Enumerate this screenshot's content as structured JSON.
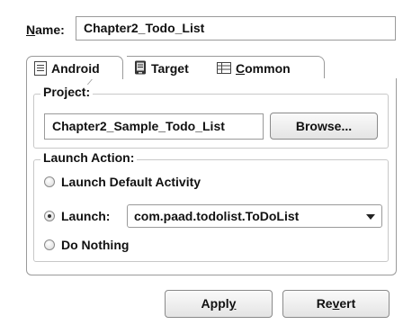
{
  "name_field": {
    "label": "Name:",
    "label_mnemonic": "N",
    "label_rest": "ame:",
    "value": "Chapter2_Todo_List"
  },
  "tabs": [
    {
      "label": "Android",
      "active": true,
      "icon": "android-document-icon"
    },
    {
      "label": "Target",
      "active": false,
      "icon": "target-device-icon"
    },
    {
      "label": "Common",
      "mnemonic": "C",
      "rest": "ommon",
      "active": false,
      "icon": "common-table-icon"
    }
  ],
  "project": {
    "group_title": "Project:",
    "value": "Chapter2_Sample_Todo_List",
    "browse_label": "Browse..."
  },
  "launch_action": {
    "group_title": "Launch Action:",
    "options": [
      {
        "label": "Launch Default Activity",
        "checked": false
      },
      {
        "label": "Launch:",
        "checked": true
      },
      {
        "label": "Do Nothing",
        "checked": false
      }
    ],
    "activity_selected": "com.paad.todolist.ToDoList"
  },
  "footer": {
    "apply_pre": "Appl",
    "apply_mnemonic": "y",
    "apply_post": "",
    "revert_pre": "Re",
    "revert_mnemonic": "v",
    "revert_post": "ert"
  }
}
